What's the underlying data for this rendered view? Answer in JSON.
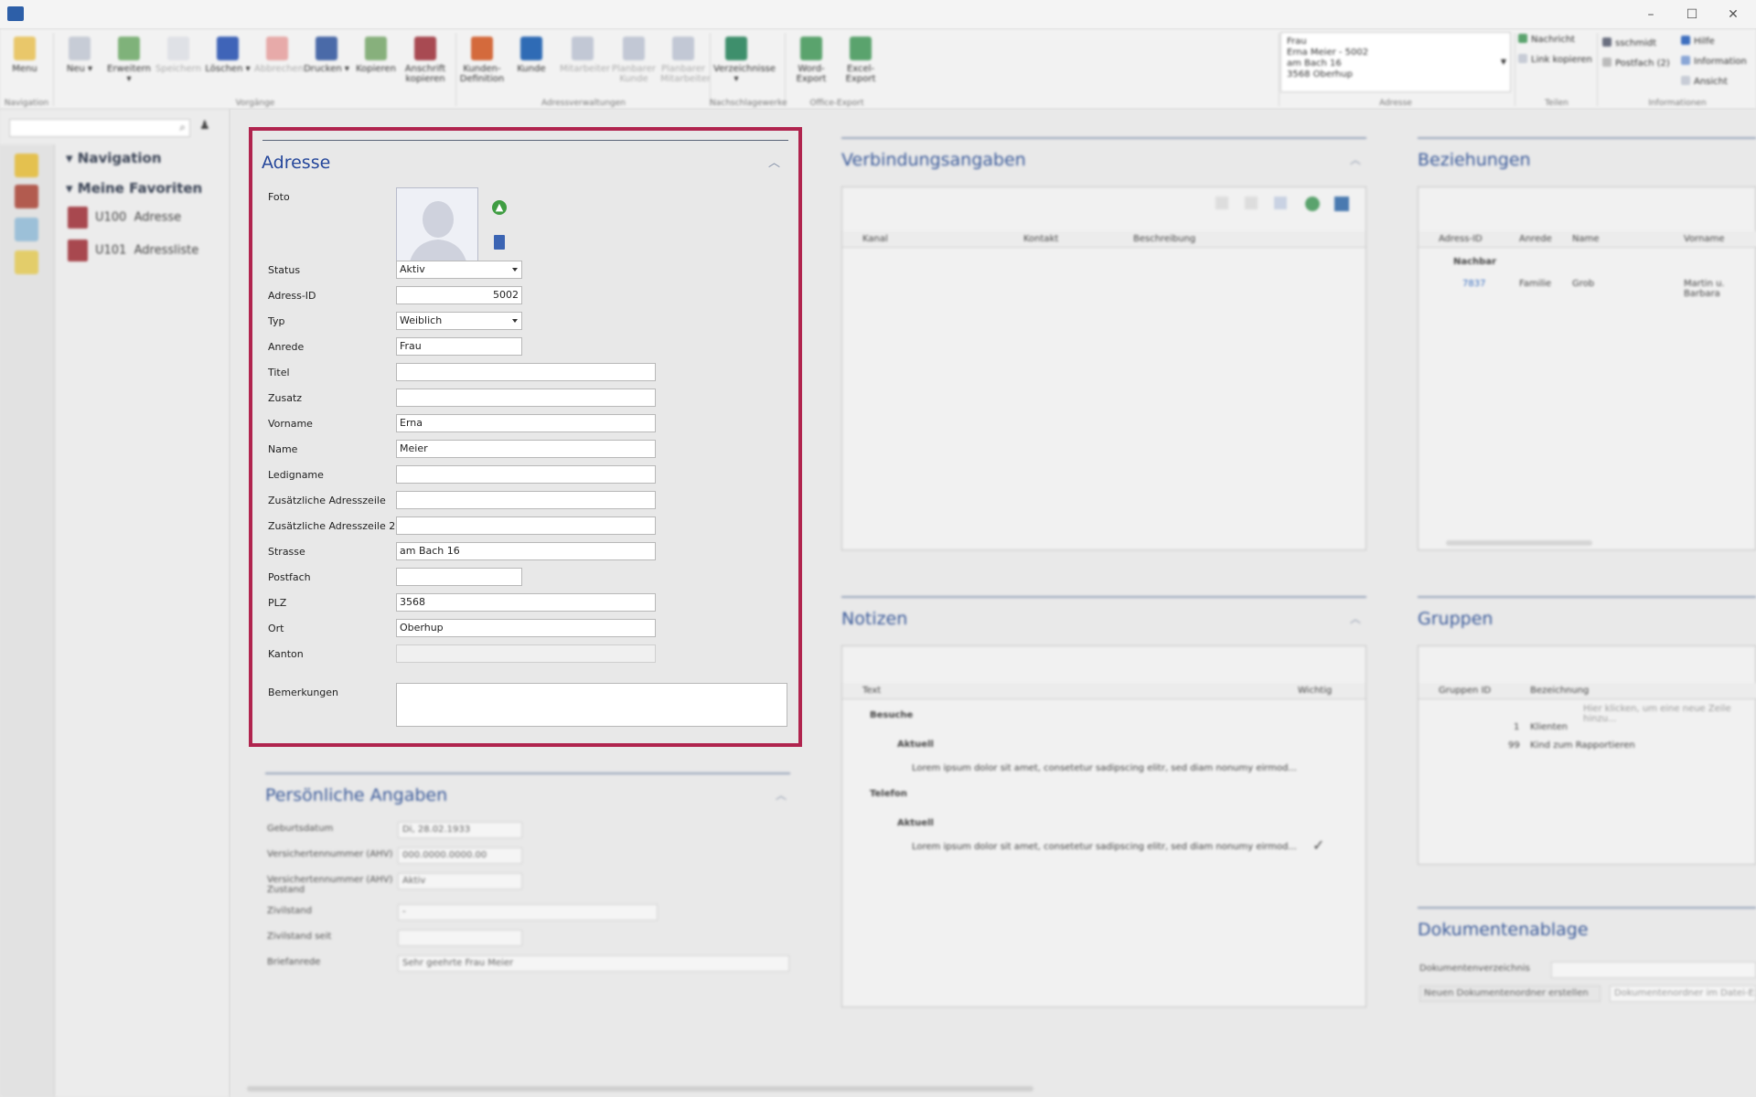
{
  "window": {
    "controls": [
      "–",
      "☐",
      "✕"
    ]
  },
  "ribbon": {
    "buttons": [
      {
        "label": "Menu",
        "color": "#e9c76a"
      },
      {
        "label": "Neu ▾",
        "color": "#c7ccd6"
      },
      {
        "label": "Erweitern ▾",
        "color": "#7fb27a"
      },
      {
        "label": "Speichern",
        "color": "#c7ccd6"
      },
      {
        "label": "Löschen ▾",
        "color": "#3f64b8"
      },
      {
        "label": "Abbrechen",
        "color": "#d9534f"
      },
      {
        "label": "Drucken ▾",
        "color": "#4a6aa8"
      },
      {
        "label": "Kopieren",
        "color": "#87b07c"
      },
      {
        "label": "Anschrift kopieren",
        "color": "#a84a52"
      },
      {
        "label": "Kunden-Definition",
        "color": "#d46a3c"
      },
      {
        "label": "Kunde",
        "color": "#2f6bb5"
      },
      {
        "label": "Mitarbeiter",
        "color": "#8895b2"
      },
      {
        "label": "Planbarer Kunde",
        "color": "#8895b2"
      },
      {
        "label": "Planbarer Mitarbeiter",
        "color": "#8895b2"
      },
      {
        "label": "Verzeichnisse ▾",
        "color": "#3e8f6c"
      },
      {
        "label": "Word-Export",
        "color": "#5aa36d"
      },
      {
        "label": "Excel-Export",
        "color": "#5aa36d"
      }
    ],
    "groups": [
      "Navigation",
      "Vorgänge",
      "Adressverwaltungen",
      "Nachschlagewerke",
      "Office-Export",
      "Adresse",
      "Teilen",
      "Informationen"
    ],
    "address_box": [
      "Frau",
      "Erna Meier - 5002",
      "am Bach 16",
      "3568 Oberhup"
    ],
    "share": [
      "Nachricht",
      "Link kopieren"
    ],
    "info": [
      "sschmidt",
      "Hilfe",
      "Postfach (2)",
      "Information",
      "Ansicht"
    ]
  },
  "nav": {
    "heading": "Navigation",
    "favorites": "Meine Favoriten",
    "items": [
      {
        "code": "U100",
        "label": "Adresse"
      },
      {
        "code": "U101",
        "label": "Adressliste"
      }
    ]
  },
  "address": {
    "title": "Adresse",
    "photo_label": "Foto",
    "fields": [
      {
        "label": "Status",
        "value": "Aktiv",
        "type": "select"
      },
      {
        "label": "Adress-ID",
        "value": "5002",
        "type": "number"
      },
      {
        "label": "Typ",
        "value": "Weiblich",
        "type": "select"
      },
      {
        "label": "Anrede",
        "value": "Frau",
        "type": "short"
      },
      {
        "label": "Titel",
        "value": "",
        "type": "text"
      },
      {
        "label": "Zusatz",
        "value": "",
        "type": "text"
      },
      {
        "label": "Vorname",
        "value": "Erna",
        "type": "text"
      },
      {
        "label": "Name",
        "value": "Meier",
        "type": "text"
      },
      {
        "label": "Ledigname",
        "value": "",
        "type": "text"
      },
      {
        "label": "Zusätzliche Adresszeile",
        "value": "",
        "type": "text"
      },
      {
        "label": "Zusätzliche Adresszeile 2",
        "value": "",
        "type": "text"
      },
      {
        "label": "Strasse",
        "value": "am Bach 16",
        "type": "text"
      },
      {
        "label": "Postfach",
        "value": "",
        "type": "short"
      },
      {
        "label": "PLZ",
        "value": "3568",
        "type": "text"
      },
      {
        "label": "Ort",
        "value": "Oberhup",
        "type": "text"
      },
      {
        "label": "Kanton",
        "value": "",
        "type": "readonly"
      }
    ],
    "remarks_label": "Bemerkungen"
  },
  "personal": {
    "title": "Persönliche Angaben",
    "fields": [
      {
        "label": "Geburtsdatum",
        "value": "Di, 28.02.1933",
        "w": "short"
      },
      {
        "label": "Versichertennummer (AHV)",
        "value": "000.0000.0000.00",
        "w": "short"
      },
      {
        "label": "Versichertennummer (AHV) Zustand",
        "value": "Aktiv",
        "w": "short"
      },
      {
        "label": "Zivilstand",
        "value": "-",
        "w": "mid"
      },
      {
        "label": "Zivilstand seit",
        "value": "",
        "w": "short"
      },
      {
        "label": "Briefanrede",
        "value": "Sehr geehrte Frau Meier",
        "w": "long"
      }
    ]
  },
  "connections": {
    "title": "Verbindungsangaben",
    "columns": [
      "Kanal",
      "Kontakt",
      "Beschreibung"
    ]
  },
  "relations": {
    "title": "Beziehungen",
    "columns": [
      "Adress-ID",
      "Anrede",
      "Name",
      "Vorname"
    ],
    "group": "Nachbar",
    "rows": [
      {
        "id": "7837",
        "anrede": "Familie",
        "name": "Grob",
        "vorname": "Martin u. Barbara"
      }
    ]
  },
  "notes": {
    "title": "Notizen",
    "columns": [
      "Text",
      "Wichtig"
    ],
    "groups": [
      "Besuche",
      "Aktuell",
      "Telefon",
      "Aktuell"
    ],
    "row_text": "Lorem ipsum dolor sit amet, consetetur sadipscing elitr, sed diam nonumy eirmod..."
  },
  "groups": {
    "title": "Gruppen",
    "columns": [
      "Gruppen ID",
      "Bezeichnung"
    ],
    "hint": "Hier klicken, um eine neue Zeile hinzu...",
    "rows": [
      {
        "id": "1",
        "label": "Klienten"
      },
      {
        "id": "99",
        "label": "Kind zum Rapportieren"
      }
    ]
  },
  "documents": {
    "title": "Dokumentenablage",
    "label": "Dokumentenverzeichnis",
    "new_button": "Neuen Dokumentenordner erstellen",
    "open_button": "Dokumentenordner im Datei-Explorer"
  }
}
